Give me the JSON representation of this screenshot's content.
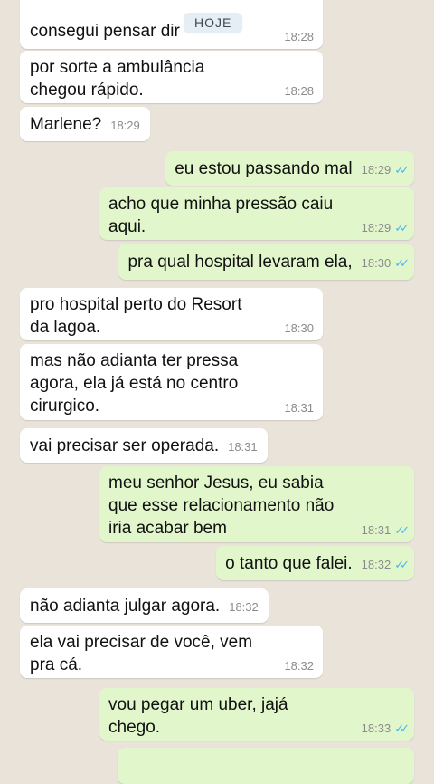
{
  "date_separator": "HOJE",
  "messages": [
    {
      "dir": "in",
      "text": "consegui pensar dir",
      "time": "18:28"
    },
    {
      "dir": "in",
      "text": "por sorte a ambulância\nchegou rápido.",
      "time": "18:28"
    },
    {
      "dir": "in",
      "text": "Marlene?",
      "time": "18:29"
    },
    {
      "dir": "out",
      "text": "eu estou passando mal",
      "time": "18:29"
    },
    {
      "dir": "out",
      "text": "acho que minha pressão caiu\naqui.",
      "time": "18:29"
    },
    {
      "dir": "out",
      "text": "pra qual hospital levaram ela,",
      "time": "18:30"
    },
    {
      "dir": "in",
      "text": "pro hospital perto do Resort\nda lagoa.",
      "time": "18:30"
    },
    {
      "dir": "in",
      "text": "mas não adianta ter pressa\nagora, ela já está no centro\ncirurgico.",
      "time": "18:31"
    },
    {
      "dir": "in",
      "text": "vai precisar ser operada.",
      "time": "18:31"
    },
    {
      "dir": "out",
      "text": "meu senhor Jesus, eu sabia\nque esse relacionamento não\niria acabar bem",
      "time": "18:31"
    },
    {
      "dir": "out",
      "text": "o tanto que falei.",
      "time": "18:32"
    },
    {
      "dir": "in",
      "text": "não adianta julgar agora.",
      "time": "18:32"
    },
    {
      "dir": "in",
      "text": "ela vai precisar de você, vem\npra cá.",
      "time": "18:32"
    },
    {
      "dir": "out",
      "text": "vou pegar um uber, jajá\nchego.",
      "time": "18:33"
    }
  ],
  "colors": {
    "background": "#e9e3da",
    "incoming_bubble": "#ffffff",
    "outgoing_bubble": "#e1f7cb",
    "read_ticks": "#4fb6ec",
    "timestamp": "#8b8b8b"
  },
  "icons": {
    "read_receipt": "double-check-icon"
  }
}
